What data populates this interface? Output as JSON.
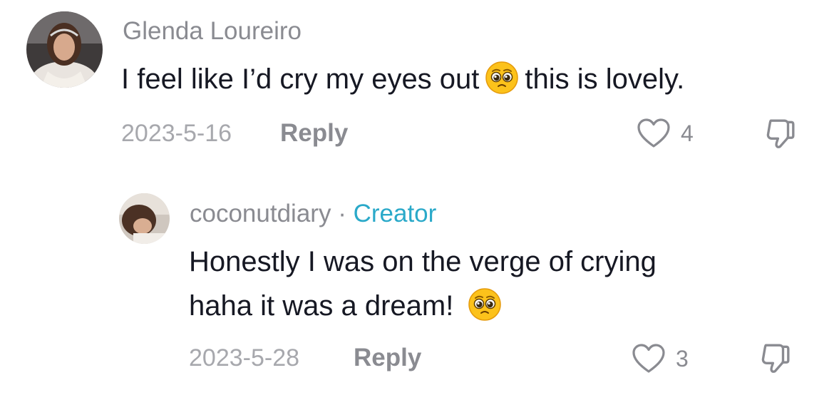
{
  "comments": [
    {
      "username": "Glenda Loureiro",
      "text_before_emoji": "I feel like I’d cry my eyes out",
      "text_after_emoji": "this is lovely.",
      "emoji": "pleading-face-emoji",
      "date": "2023-5-16",
      "reply_label": "Reply",
      "like_count": "4"
    },
    {
      "username": "coconutdiary",
      "separator": "·",
      "badge": "Creator",
      "text_line_1": "Honestly I was on the verge of crying",
      "text_line_2": "haha it was a dream!",
      "emoji": "pleading-face-emoji",
      "date": "2023-5-28",
      "reply_label": "Reply",
      "like_count": "3"
    }
  ],
  "icons": {
    "like": "heart-outline-icon",
    "dislike": "thumbs-down-icon"
  },
  "colors": {
    "text": "#161823",
    "secondary_text": "#8a8b91",
    "date_text": "#a7a8ad",
    "creator_badge": "#2aa9c9"
  }
}
